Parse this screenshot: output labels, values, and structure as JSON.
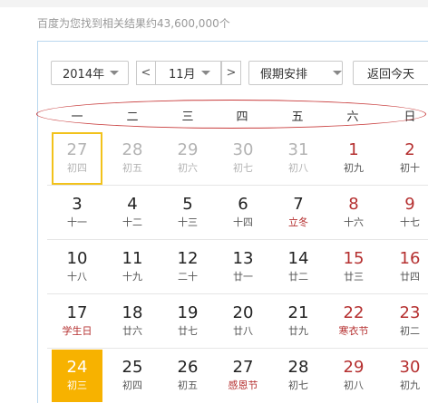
{
  "search": {
    "result_count": "百度为您找到相关结果约43,600,000个"
  },
  "calendar": {
    "year_select": "2014年",
    "prev_month": "<",
    "month_select": "11月",
    "next_month": ">",
    "holiday_select": "假期安排",
    "today_button": "返回今天",
    "weekdays": [
      "一",
      "二",
      "三",
      "四",
      "五",
      "六",
      "日"
    ],
    "weeks": [
      [
        {
          "day": "27",
          "lunar": "初四",
          "style": "gray",
          "selected": true
        },
        {
          "day": "28",
          "lunar": "初五",
          "style": "gray"
        },
        {
          "day": "29",
          "lunar": "初六",
          "style": "gray"
        },
        {
          "day": "30",
          "lunar": "初七",
          "style": "gray"
        },
        {
          "day": "31",
          "lunar": "初八",
          "style": "gray"
        },
        {
          "day": "1",
          "lunar": "初九",
          "style": "red"
        },
        {
          "day": "2",
          "lunar": "初十",
          "style": "red"
        }
      ],
      [
        {
          "day": "3",
          "lunar": "十一",
          "style": "black"
        },
        {
          "day": "4",
          "lunar": "十二",
          "style": "black"
        },
        {
          "day": "5",
          "lunar": "十三",
          "style": "black"
        },
        {
          "day": "6",
          "lunar": "十四",
          "style": "black"
        },
        {
          "day": "7",
          "lunar": "立冬",
          "style": "redhol"
        },
        {
          "day": "8",
          "lunar": "十六",
          "style": "red"
        },
        {
          "day": "9",
          "lunar": "十七",
          "style": "red"
        }
      ],
      [
        {
          "day": "10",
          "lunar": "十八",
          "style": "black"
        },
        {
          "day": "11",
          "lunar": "十九",
          "style": "black"
        },
        {
          "day": "12",
          "lunar": "二十",
          "style": "black"
        },
        {
          "day": "13",
          "lunar": "廿一",
          "style": "black"
        },
        {
          "day": "14",
          "lunar": "廿二",
          "style": "black"
        },
        {
          "day": "15",
          "lunar": "廿三",
          "style": "red"
        },
        {
          "day": "16",
          "lunar": "廿四",
          "style": "red"
        }
      ],
      [
        {
          "day": "17",
          "lunar": "学生日",
          "style": "redhol"
        },
        {
          "day": "18",
          "lunar": "廿六",
          "style": "black"
        },
        {
          "day": "19",
          "lunar": "廿七",
          "style": "black"
        },
        {
          "day": "20",
          "lunar": "廿八",
          "style": "black"
        },
        {
          "day": "21",
          "lunar": "廿九",
          "style": "black"
        },
        {
          "day": "22",
          "lunar": "寒衣节",
          "style": "redhol2"
        },
        {
          "day": "23",
          "lunar": "初二",
          "style": "red"
        }
      ],
      [
        {
          "day": "24",
          "lunar": "初三",
          "style": "black",
          "today": true
        },
        {
          "day": "25",
          "lunar": "初四",
          "style": "black"
        },
        {
          "day": "26",
          "lunar": "初五",
          "style": "black"
        },
        {
          "day": "27",
          "lunar": "感恩节",
          "style": "redhol"
        },
        {
          "day": "28",
          "lunar": "初七",
          "style": "black"
        },
        {
          "day": "29",
          "lunar": "初八",
          "style": "red"
        },
        {
          "day": "30",
          "lunar": "初九",
          "style": "red"
        }
      ]
    ]
  }
}
